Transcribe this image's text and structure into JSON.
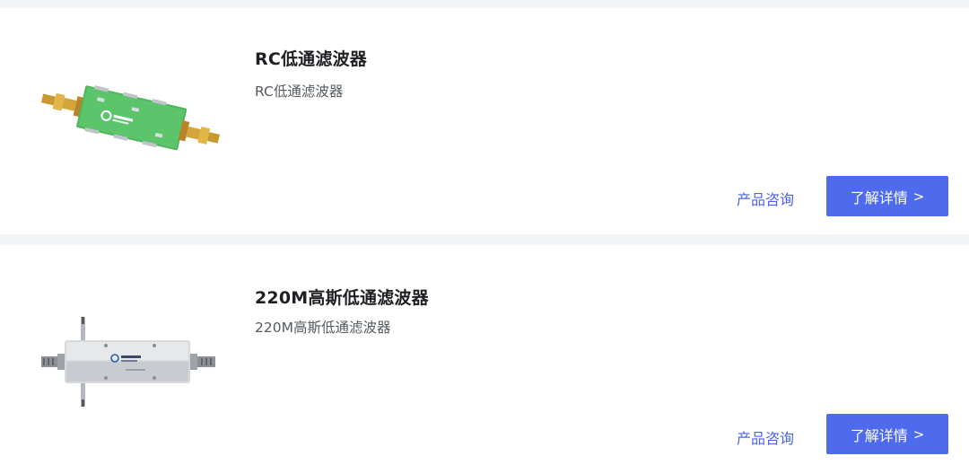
{
  "products": [
    {
      "title": "RC低通滤波器",
      "subtitle": "RC低通滤波器",
      "image_icon": "green-pcb-filter-image",
      "consult_label": "产品咨询",
      "detail_label": "了解详情",
      "detail_chevron": ">"
    },
    {
      "title": "220M高斯低通滤波器",
      "subtitle": "220M高斯低通滤波器",
      "image_icon": "silver-metal-filter-image",
      "consult_label": "产品咨询",
      "detail_label": "了解详情",
      "detail_chevron": ">"
    }
  ],
  "colors": {
    "accent": "#4f6bed",
    "link": "#4a63e7",
    "page_background": "#f3f4f7",
    "card_background": "#ffffff"
  }
}
